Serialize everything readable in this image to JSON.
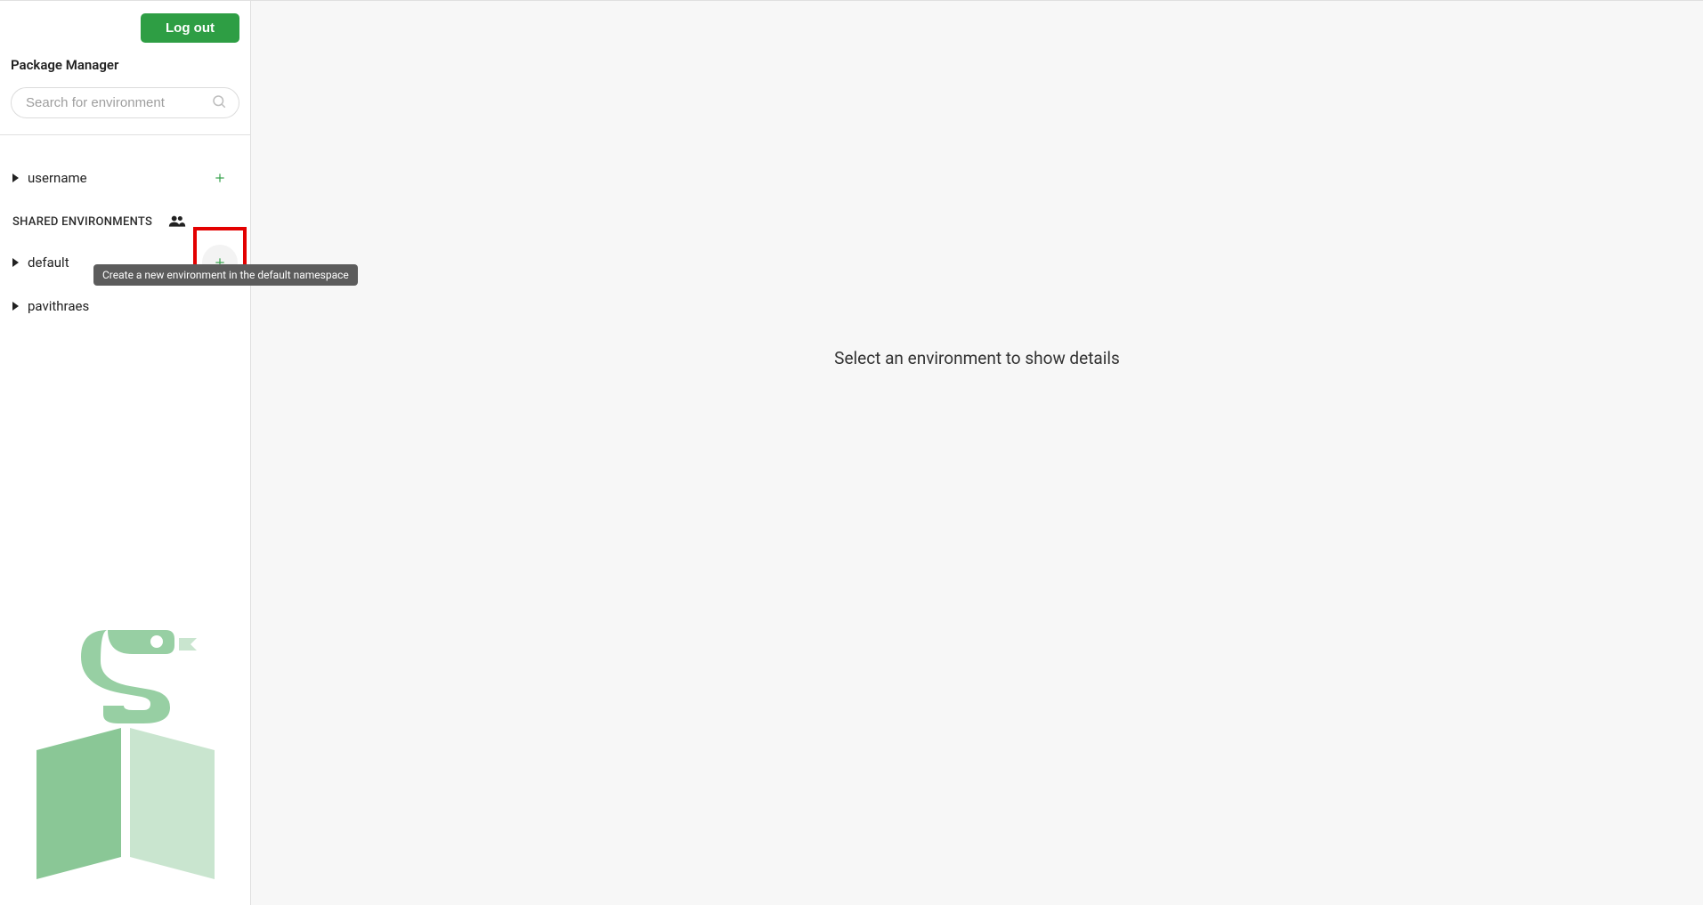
{
  "header": {
    "logout_label": "Log out",
    "app_title": "Package Manager",
    "search_placeholder": "Search for environment"
  },
  "sidebar": {
    "user_namespace": {
      "label": "username"
    },
    "shared_section_label": "SHARED ENVIRONMENTS",
    "shared_namespaces": [
      {
        "label": "default"
      },
      {
        "label": "pavithraes"
      }
    ]
  },
  "tooltip_text": "Create a new environment in the default namespace",
  "main": {
    "placeholder": "Select an environment to show details"
  }
}
